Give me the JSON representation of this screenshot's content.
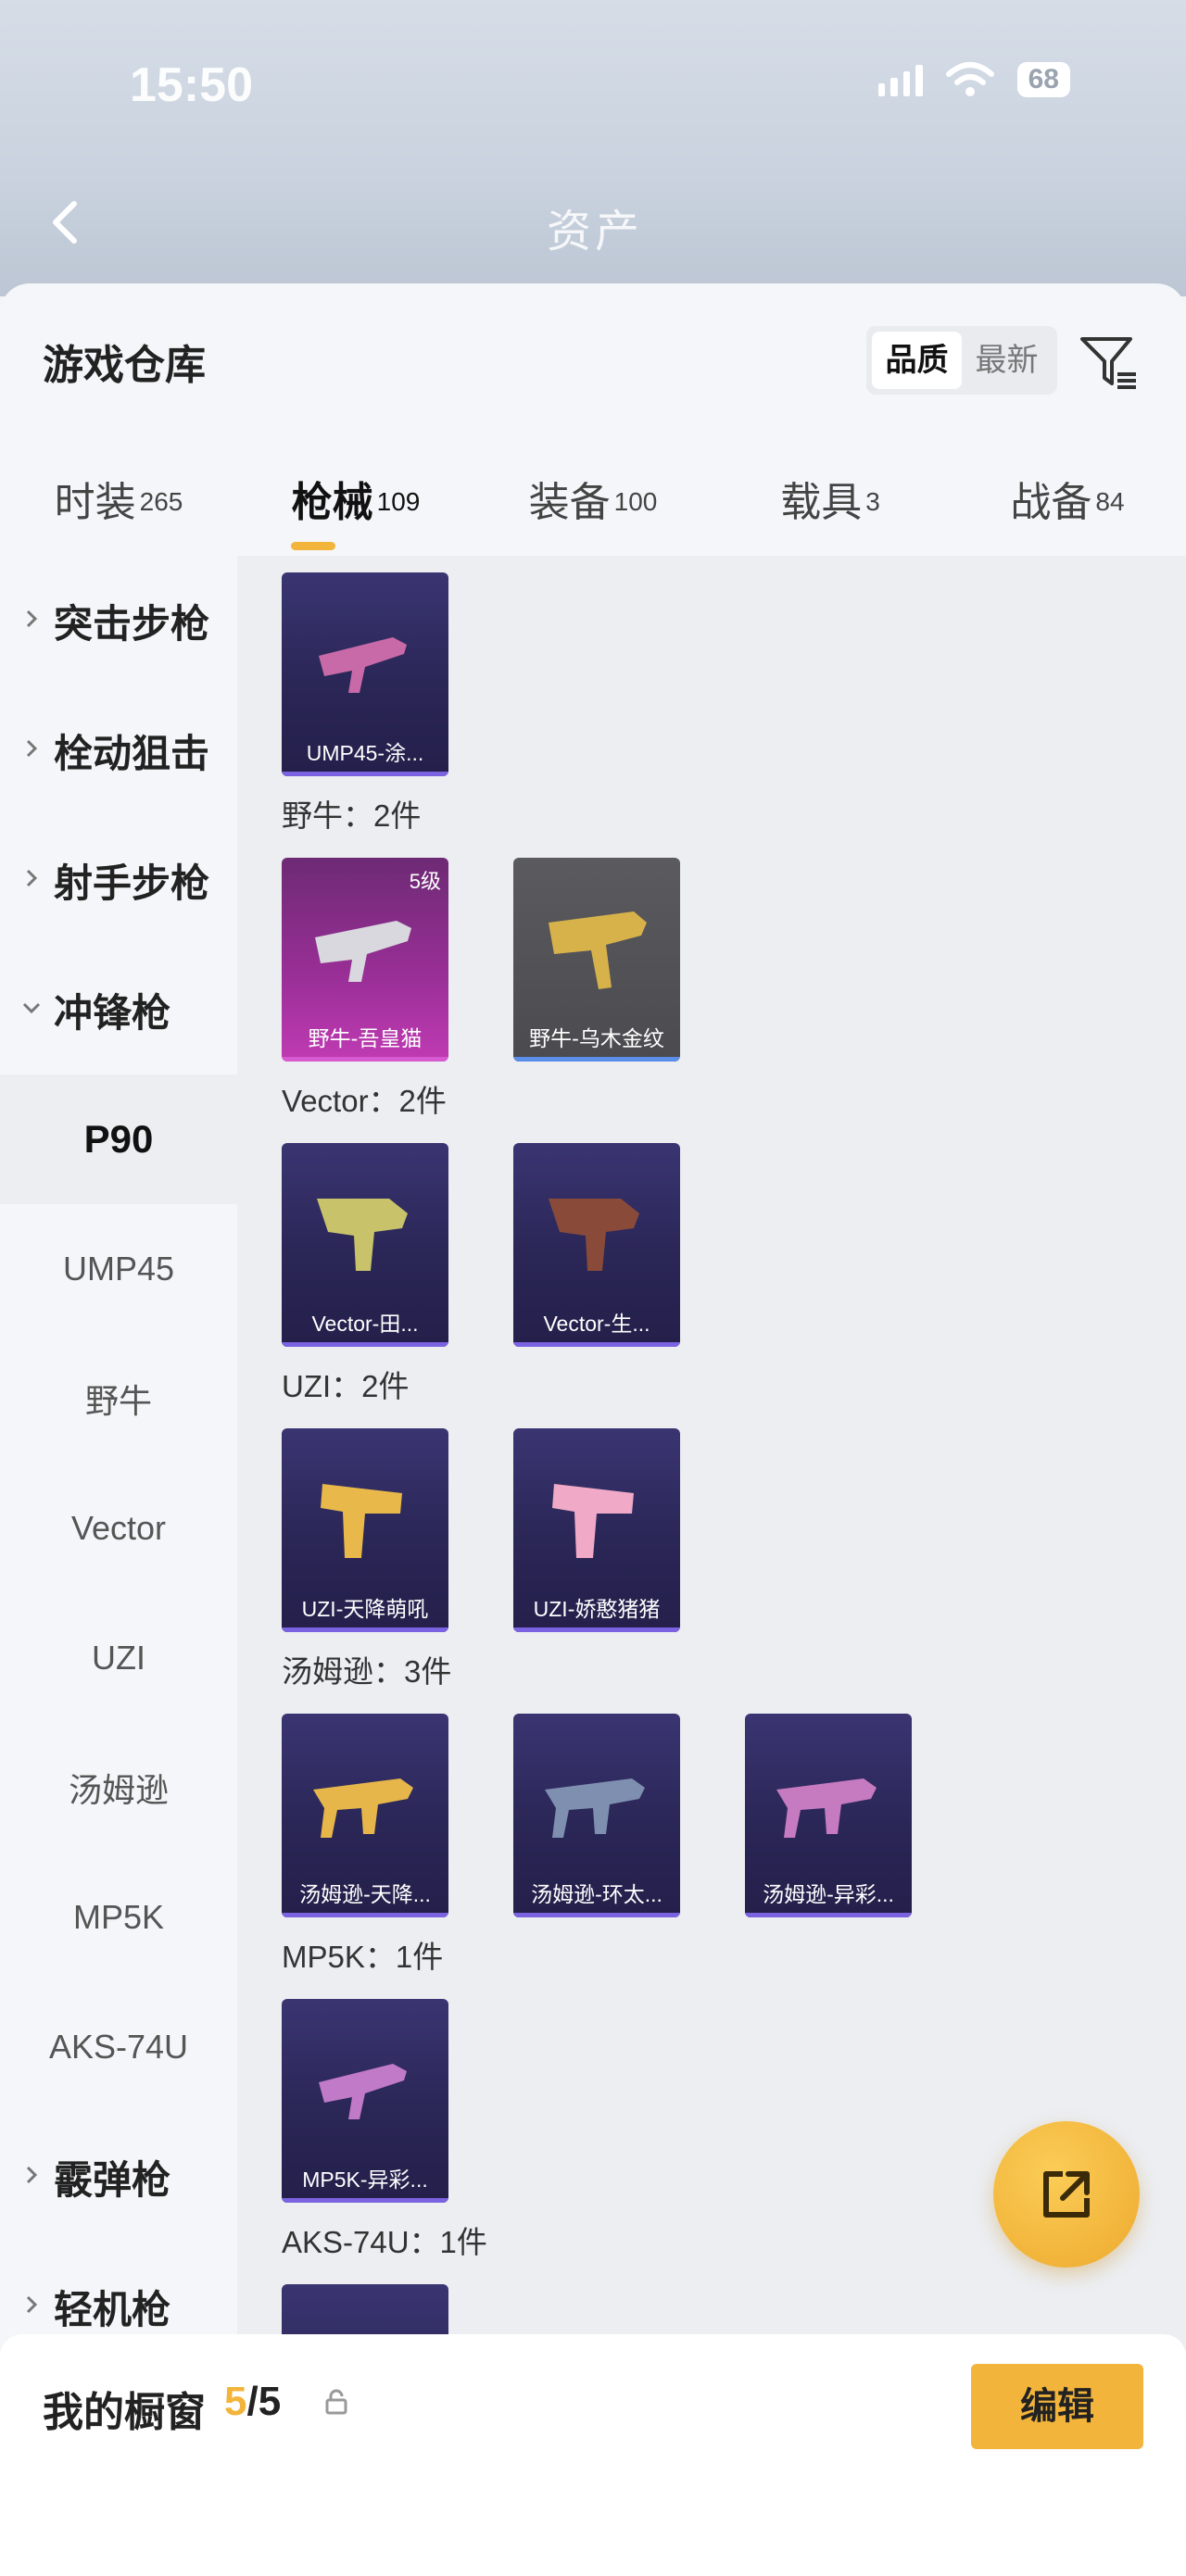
{
  "status": {
    "time": "15:50",
    "battery": "68"
  },
  "top_nav": {
    "title": "资产"
  },
  "sheet": {
    "title": "游戏仓库",
    "sort": {
      "options": [
        "品质",
        "最新"
      ],
      "selected": "品质"
    }
  },
  "tabs": [
    {
      "label": "时装",
      "count": "265"
    },
    {
      "label": "枪械",
      "count": "109",
      "active": true
    },
    {
      "label": "装备",
      "count": "100"
    },
    {
      "label": "载具",
      "count": "3"
    },
    {
      "label": "战备",
      "count": "84"
    }
  ],
  "sidebar": {
    "categories": [
      {
        "label": "突击步枪",
        "expanded": false
      },
      {
        "label": "栓动狙击",
        "expanded": false
      },
      {
        "label": "射手步枪",
        "expanded": false
      },
      {
        "label": "冲锋枪",
        "expanded": true
      }
    ],
    "subitems": [
      "P90",
      "UMP45",
      "野牛",
      "Vector",
      "UZI",
      "汤姆逊",
      "MP5K",
      "AKS-74U"
    ],
    "active_sub": "P90",
    "categories_after": [
      {
        "label": "霰弹枪",
        "expanded": false
      },
      {
        "label": "轻机枪",
        "expanded": false
      }
    ]
  },
  "content": {
    "top_card": {
      "name": "UMP45-涂...",
      "color": "#c96aa8"
    },
    "groups": [
      {
        "label": "野牛：2件",
        "cards": [
          {
            "name": "野牛-吾皇猫",
            "level": "5级",
            "style": "pink",
            "color": "#d8d8de"
          },
          {
            "name": "野牛-乌木金纹",
            "style": "gray",
            "color": "#d7b24a"
          }
        ]
      },
      {
        "label": "Vector：2件",
        "cards": [
          {
            "name": "Vector-田...",
            "color": "#c8c36a"
          },
          {
            "name": "Vector-生...",
            "color": "#8a4a3a"
          }
        ]
      },
      {
        "label": "UZI：2件",
        "cards": [
          {
            "name": "UZI-天降萌吼",
            "color": "#e8b84a"
          },
          {
            "name": "UZI-娇憨猪猪",
            "color": "#f0a9c7"
          }
        ]
      },
      {
        "label": "汤姆逊：3件",
        "cards": [
          {
            "name": "汤姆逊-天降...",
            "color": "#e6b64a"
          },
          {
            "name": "汤姆逊-环太...",
            "color": "#7f8fb0"
          },
          {
            "name": "汤姆逊-异彩...",
            "color": "#c67ac0"
          }
        ]
      },
      {
        "label": "MP5K：1件",
        "cards": [
          {
            "name": "MP5K-异彩...",
            "color": "#c07ac8"
          }
        ]
      },
      {
        "label": "AKS-74U：1件",
        "cards": []
      }
    ]
  },
  "bottom": {
    "window_label": "我的橱窗",
    "window_current": "5",
    "window_total": "/5",
    "edit_label": "编辑"
  },
  "colors": {
    "accent": "#f2b43a",
    "card_bg": "#2a2656",
    "card_pink": "#9b2f98"
  },
  "icons": [
    "back-icon",
    "filter-icon",
    "share-icon",
    "lock-icon",
    "chevron-right-icon",
    "chevron-down-icon",
    "signal-icon",
    "wifi-icon",
    "battery-icon"
  ]
}
